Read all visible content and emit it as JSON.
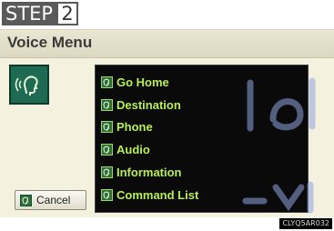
{
  "step": {
    "label": "STEP",
    "number": "2"
  },
  "title": "Voice Menu",
  "menu": {
    "items": [
      {
        "label": "Go Home",
        "icon": "voice-command-icon"
      },
      {
        "label": "Destination",
        "icon": "voice-command-icon"
      },
      {
        "label": "Phone",
        "icon": "voice-command-icon"
      },
      {
        "label": "Audio",
        "icon": "voice-command-icon"
      },
      {
        "label": "Information",
        "icon": "voice-command-icon"
      },
      {
        "label": "Command List",
        "icon": "voice-command-icon"
      }
    ]
  },
  "cancel": {
    "label": "Cancel",
    "icon": "cancel-icon"
  },
  "image_code": "CLYQ5AR032",
  "colors": {
    "menu_text": "#b8ee55",
    "panel_bg": "#0a0a0a",
    "screen_bg": "#f4f1df",
    "voice_tile": "#1e6a52"
  }
}
